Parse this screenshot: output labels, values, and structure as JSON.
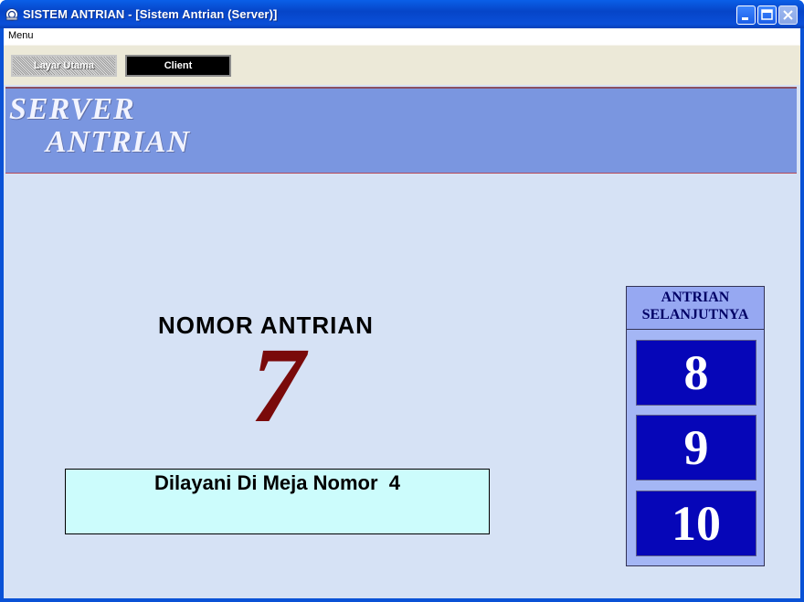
{
  "window": {
    "title": "SISTEM ANTRIAN - [Sistem Antrian (Server)]",
    "icon": "app-icon"
  },
  "menubar": {
    "items": [
      "Menu"
    ]
  },
  "toolbar": {
    "layar_utama_label": "Layar Utama",
    "client_label": "Client"
  },
  "header": {
    "line1": "SERVER",
    "line2": "ANTRIAN"
  },
  "main": {
    "nomor_label": "NOMOR ANTRIAN",
    "nomor_value": "7",
    "counter_text": "Dilayani Di Meja Nomor  4"
  },
  "next_queue": {
    "title_line1": "ANTRIAN",
    "title_line2": "SELANJUTNYA",
    "numbers": [
      "8",
      "9",
      "10"
    ]
  },
  "colors": {
    "titlebar": "#0a52d6",
    "header_panel": "#7a96e0",
    "content_bg": "#d6e2f5",
    "number_color": "#7a0a0a",
    "next_box": "#0606b8",
    "counter_box": "#ccfcfc"
  }
}
